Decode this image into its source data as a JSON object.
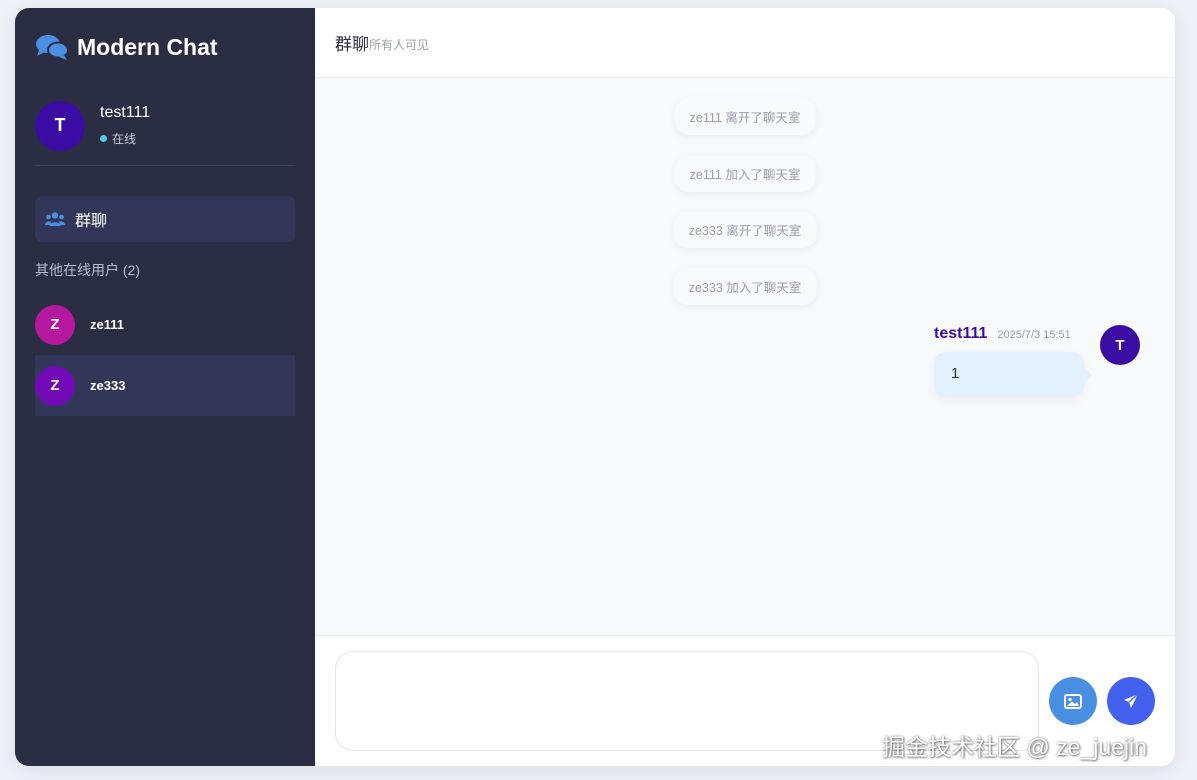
{
  "colors": {
    "sidebar_bg": "#2b2d42",
    "accent": "#4a7ae6",
    "self_avatar": "#3a0ca3",
    "online_dot": "#4cc9f0",
    "bubble_bg": "#e3f0fd"
  },
  "app": {
    "title": "Modern Chat"
  },
  "current_user": {
    "initial": "T",
    "name": "test111",
    "status": "在线"
  },
  "sidebar": {
    "group_label": "群聊",
    "online_section": "其他在线用户 (2)",
    "users": [
      {
        "initial": "Z",
        "name": "ze111",
        "color": "#b5179e"
      },
      {
        "initial": "Z",
        "name": "ze333",
        "color": "#7209b7"
      }
    ]
  },
  "chat": {
    "title": "群聊",
    "subtitle": "所有人可见",
    "system_messages": [
      "ze111 离开了聊天室",
      "ze111 加入了聊天室",
      "ze333 离开了聊天室",
      "ze333 加入了聊天室"
    ],
    "message": {
      "author": "test111",
      "initial": "T",
      "time": "2025/7/3 15:51",
      "text": "1"
    }
  },
  "composer": {
    "input_value": "",
    "image_button_icon": "image-icon",
    "send_button_icon": "send-icon"
  },
  "watermark": "掘金技术社区 @ ze_juejin"
}
